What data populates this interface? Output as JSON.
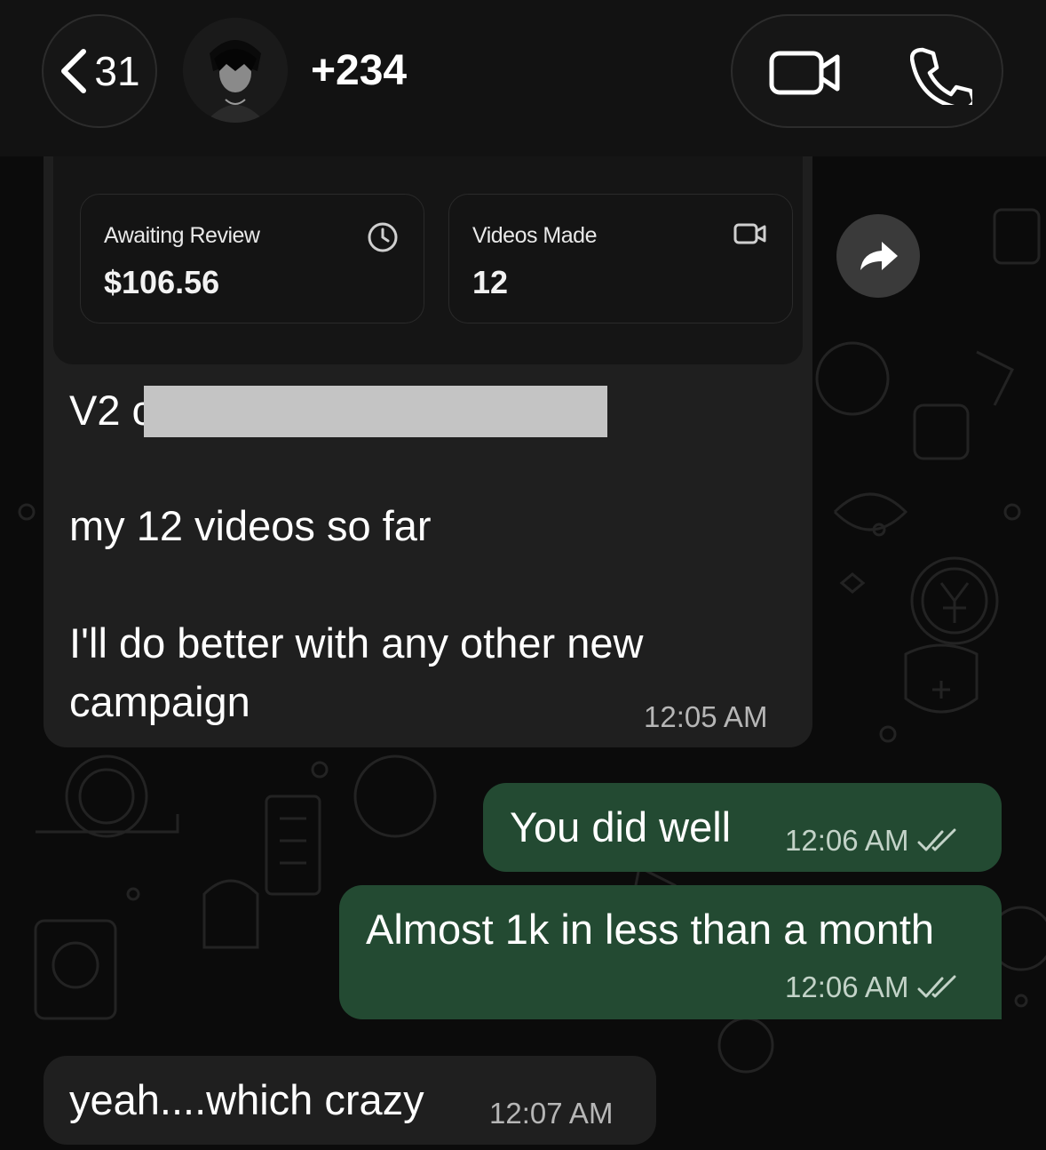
{
  "header": {
    "back_count": "31",
    "contact_name": "+234"
  },
  "messages": {
    "card": {
      "stat1_label": "Awaiting Review",
      "stat1_value": "$106.56",
      "stat2_label": "Videos Made",
      "stat2_value": "12"
    },
    "msg1_line1": "V2 c",
    "msg1_line2": "my 12 videos so far",
    "msg1_line3": "I'll do better with any other new",
    "msg1_line4": "campaign",
    "msg1_time": "12:05 AM",
    "msg2_text": "You did well",
    "msg2_time": "12:06 AM",
    "msg3_text": "Almost 1k in less than a month",
    "msg3_time": "12:06 AM",
    "msg4_text": "yeah....which crazy",
    "msg4_time": "12:07 AM"
  },
  "colors": {
    "sent_bubble": "#234a32",
    "received_bubble": "#1f1f1f",
    "background": "#0b0b0b"
  }
}
